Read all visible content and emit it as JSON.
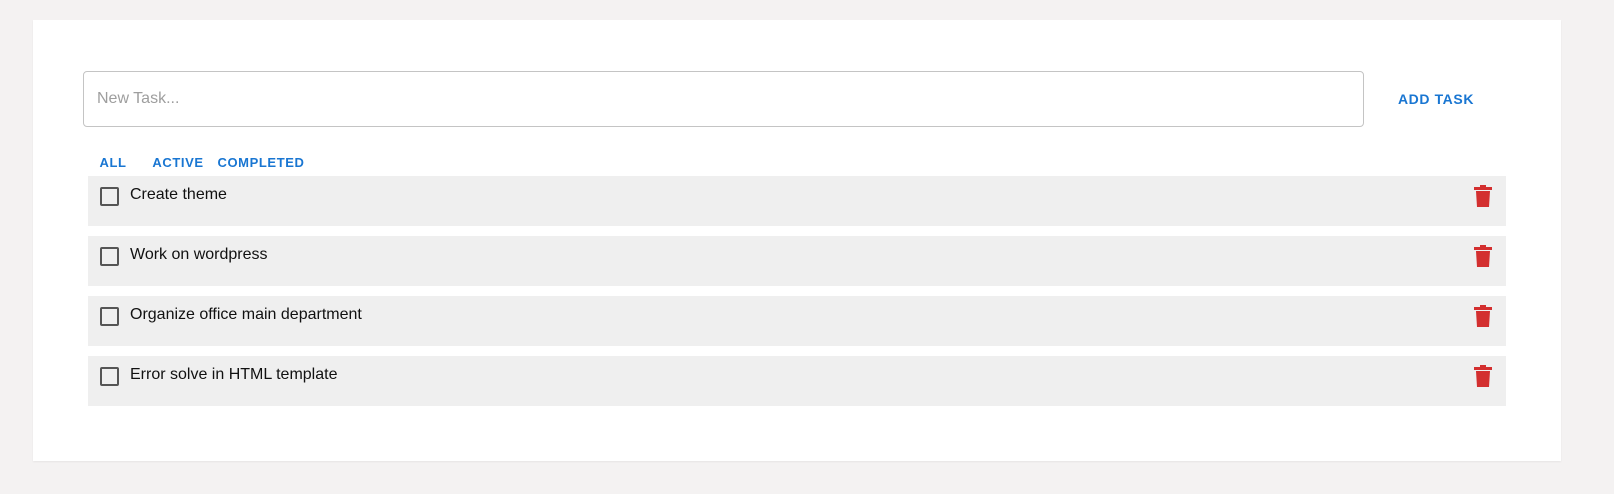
{
  "new_task": {
    "placeholder": "New Task...",
    "value": "",
    "add_label": "ADD TASK"
  },
  "filters": {
    "all": "ALL",
    "active": "ACTIVE",
    "completed": "COMPLETED"
  },
  "tasks": [
    {
      "text": "Create theme",
      "completed": false
    },
    {
      "text": "Work on wordpress",
      "completed": false
    },
    {
      "text": "Organize office main department",
      "completed": false
    },
    {
      "text": "Error solve in HTML template",
      "completed": false
    }
  ],
  "colors": {
    "accent": "#1976d2",
    "delete": "#d32f2f",
    "row_bg": "#efefef",
    "page_bg": "#f4f2f2"
  },
  "icons": {
    "delete": "trash-icon",
    "checkbox": "checkbox-unchecked-icon"
  }
}
